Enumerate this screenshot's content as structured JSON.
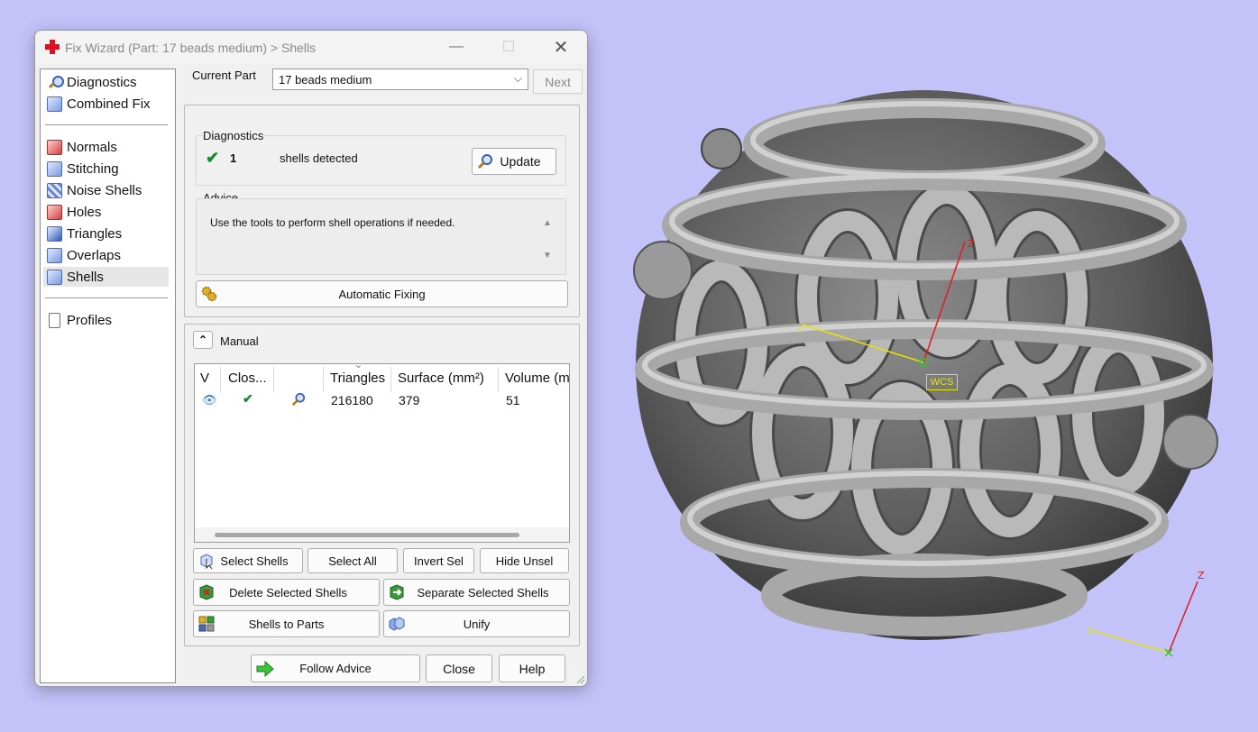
{
  "window": {
    "title": "Fix Wizard (Part: 17 beads medium) > Shells",
    "min_glyph": "—",
    "max_glyph": "☐",
    "close_glyph": "✕"
  },
  "nav": {
    "group1": [
      {
        "label": "Diagnostics",
        "icon": "magnifier-icon"
      },
      {
        "label": "Combined Fix",
        "icon": "cube-icon"
      }
    ],
    "group2": [
      {
        "label": "Normals",
        "icon": "normals-icon"
      },
      {
        "label": "Stitching",
        "icon": "stitching-icon"
      },
      {
        "label": "Noise Shells",
        "icon": "noise-shells-icon"
      },
      {
        "label": "Holes",
        "icon": "holes-icon"
      },
      {
        "label": "Triangles",
        "icon": "triangles-icon"
      },
      {
        "label": "Overlaps",
        "icon": "overlaps-icon"
      },
      {
        "label": "Shells",
        "icon": "shells-icon",
        "selected": true
      }
    ],
    "group3": [
      {
        "label": "Profiles",
        "icon": "document-icon"
      }
    ]
  },
  "header": {
    "current_part_label": "Current Part",
    "current_part_value": "17 beads medium",
    "dropdown_glyph": "⌵",
    "next_label": "Next"
  },
  "diagnostics": {
    "title": "Diagnostics",
    "check_glyph": "✔",
    "count": "1",
    "text": "shells detected",
    "update_label": "Update"
  },
  "advice": {
    "title": "Advice",
    "text": "Use the tools to perform shell operations if needed.",
    "up_glyph": "▲",
    "down_glyph": "▼"
  },
  "automatic_fixing": {
    "label": "Automatic Fixing"
  },
  "manual": {
    "collapse_glyph": "⌃",
    "title": "Manual",
    "sort_glyph": "⌄",
    "columns": [
      "V",
      "Clos...",
      "",
      "Triangles",
      "Surface (mm²)",
      "Volume (m"
    ],
    "rows": [
      {
        "visible_glyph": "👁",
        "closed_glyph": "✔",
        "triangles": "216180",
        "surface": "379",
        "volume": "51"
      }
    ]
  },
  "actions": {
    "select_shells": "Select Shells",
    "select_all": "Select All",
    "invert_sel": "Invert Sel",
    "hide_unsel": "Hide Unsel",
    "delete_selected": "Delete Selected Shells",
    "separate_selected": "Separate Selected Shells",
    "shells_to_parts": "Shells to Parts",
    "unify": "Unify"
  },
  "footer": {
    "follow_advice": "Follow Advice",
    "close": "Close",
    "help": "Help"
  },
  "viewport": {
    "wcs_label": "WCS",
    "axis_z": "Z",
    "axis_y": "Y",
    "colors": {
      "background": "#c3c3fa",
      "x_axis": "#e01c1c",
      "y_axis": "#e5e500",
      "z_axis": "#e01c1c"
    }
  }
}
